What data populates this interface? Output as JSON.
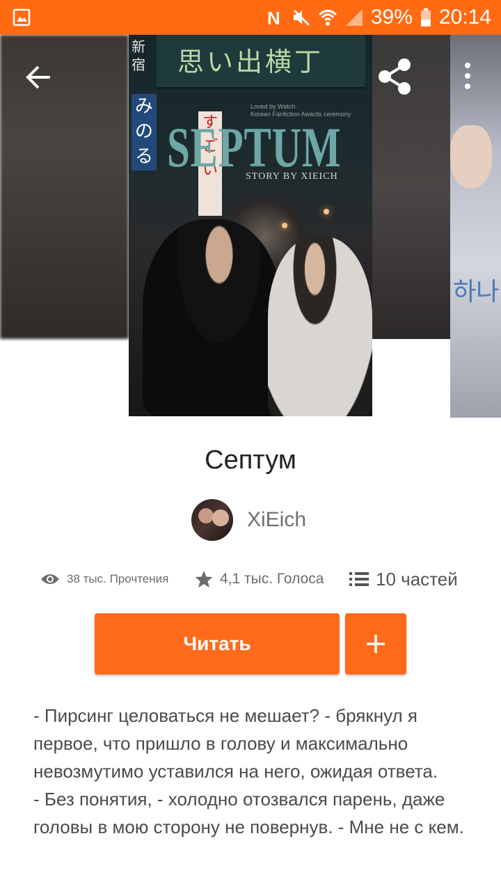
{
  "status_bar": {
    "battery_percent": "39%",
    "time": "20:14",
    "icons": [
      "gallery-icon",
      "nfc-icon",
      "mute-icon",
      "wifi-icon",
      "signal-icon",
      "battery-icon"
    ]
  },
  "header": {
    "back_icon": "arrow-left-icon",
    "share_icon": "share-icon",
    "more_icon": "more-vertical-icon"
  },
  "cover": {
    "sign_text": "思い出横丁",
    "kanji_left": "新宿",
    "kanji_blue": "みのる",
    "red_sign": "すごい",
    "title_text": "SEPTUM",
    "byline": "STORY BY XIEICH",
    "small_top": "Loved by Watch\nKorean Fanfiction Awards ceremony",
    "side_cover_text": "하나"
  },
  "book": {
    "title": "Септум",
    "author": "XiEich"
  },
  "stats": {
    "reads": "38 тыс. Прочтения",
    "votes": "4,1 тыс. Голоса",
    "parts": "10 частей"
  },
  "actions": {
    "read_label": "Читать",
    "add_icon": "plus-icon"
  },
  "description": "- Пирсинг целоваться не мешает? - брякнул я первое, что пришло в голову и максимально невозмутимо уставился на него, ожидая ответа.\n- Без понятия, - холодно отозвался парень, даже головы в мою сторону не повернув. - Мне не с кем.",
  "colors": {
    "accent": "#ff6b1a",
    "status_bar": "#ff6a13",
    "text_muted": "#6b6b6b"
  }
}
